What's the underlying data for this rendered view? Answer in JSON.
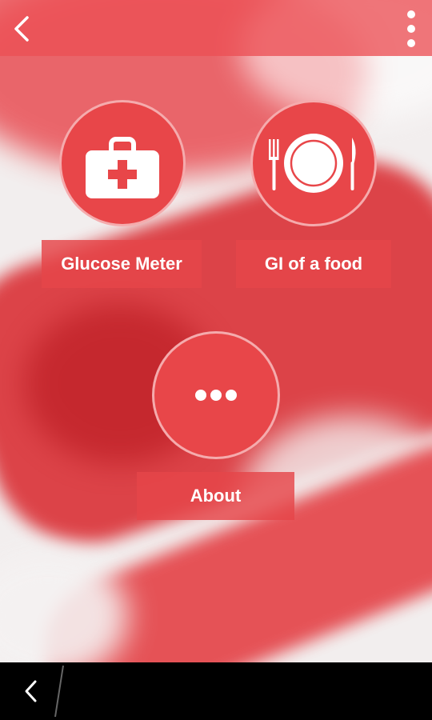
{
  "header": {
    "back_icon": "chevron-left-icon",
    "menu_icon": "more-vertical-icon"
  },
  "menu_tiles": [
    {
      "id": "glucose-meter",
      "label": "Glucose Meter",
      "icon": "first-aid-kit-icon"
    },
    {
      "id": "gi-of-food",
      "label": "GI of a food",
      "icon": "plate-cutlery-icon"
    },
    {
      "id": "about",
      "label": "About",
      "icon": "more-horizontal-icon"
    }
  ],
  "navbar": {
    "back_icon": "system-back-icon"
  },
  "colors": {
    "accent": "#e84649",
    "bar": "#ec5054",
    "navbar": "#000000"
  }
}
